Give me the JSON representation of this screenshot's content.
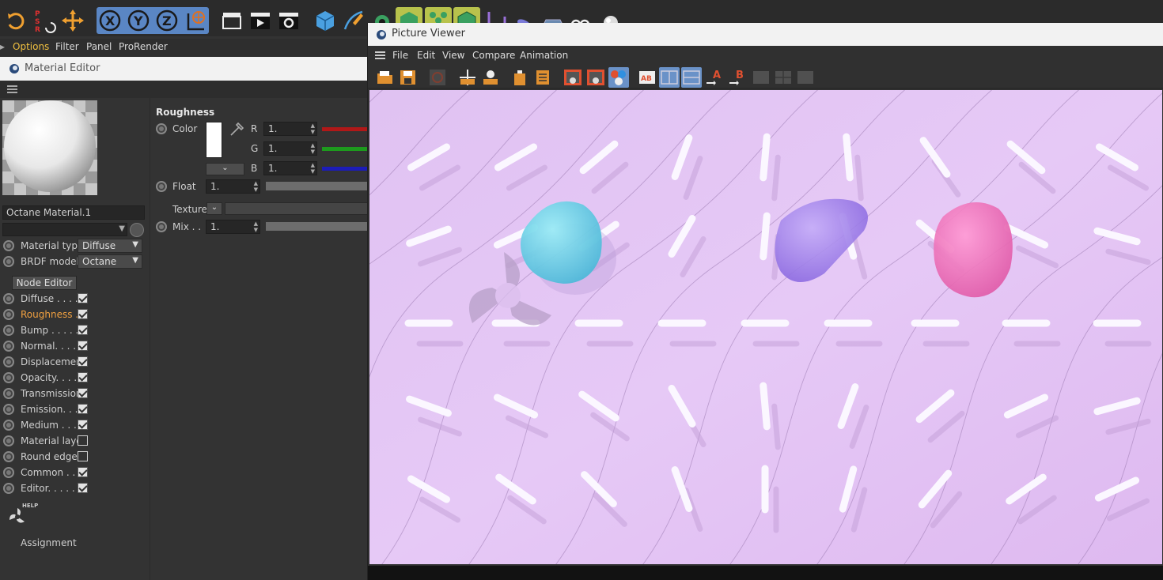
{
  "colors": {
    "accent_blue": "#5a86c4",
    "highlight_yellow": "#b8c24c",
    "active_orange": "#f0a040",
    "render_bg": "#e4c4f4",
    "blob_cyan": "#6fd6e4",
    "blob_purple": "#a98af0",
    "blob_pink": "#f57ac0"
  },
  "top_toolbar": {
    "icons": [
      "undo-icon",
      "psr-icon",
      "move-icon",
      "x-axis-icon",
      "y-axis-icon",
      "z-axis-icon",
      "world-coord-icon",
      "clapper-icon",
      "render-view-icon",
      "render-settings-icon",
      "cube-icon",
      "pen-icon",
      "generator-icon",
      "subdivision-icon",
      "cloner-icon",
      "deformer-icon",
      "bend-icon",
      "bevel-icon",
      "floor-icon",
      "camera-icon",
      "light-icon"
    ],
    "psr_label": "P\nS\nR",
    "x_label": "X",
    "y_label": "Y",
    "z_label": "Z"
  },
  "menubar": {
    "items": [
      {
        "label": "Options",
        "active": true
      },
      {
        "label": "Filter",
        "active": false
      },
      {
        "label": "Panel",
        "active": false
      },
      {
        "label": "ProRender",
        "active": false
      }
    ],
    "left_stub": "▸"
  },
  "material_editor": {
    "title": "Material Editor",
    "material_name": "Octane Material.1",
    "material_type_label": "Material type",
    "material_type_value": "Diffuse",
    "brdf_label": "BRDF model",
    "brdf_value": "Octane",
    "node_editor_label": "Node Editor",
    "channels": [
      {
        "label": "Diffuse . . . .",
        "checked": true,
        "active": false
      },
      {
        "label": "Roughness .",
        "checked": true,
        "active": true
      },
      {
        "label": "Bump . . . . .",
        "checked": true,
        "active": false
      },
      {
        "label": "Normal. . . .",
        "checked": true,
        "active": false
      },
      {
        "label": "Displacement",
        "checked": true,
        "active": false
      },
      {
        "label": "Opacity. . . .",
        "checked": true,
        "active": false
      },
      {
        "label": "Transmission",
        "checked": true,
        "active": false
      },
      {
        "label": "Emission. . .",
        "checked": true,
        "active": false
      },
      {
        "label": "Medium . . .",
        "checked": true,
        "active": false
      },
      {
        "label": "Material layer",
        "checked": false,
        "active": false
      },
      {
        "label": "Round edges",
        "checked": false,
        "active": false
      },
      {
        "label": "Common . .",
        "checked": true,
        "active": false
      },
      {
        "label": "Editor. . . . .",
        "checked": true,
        "active": false
      }
    ],
    "help_label": "HELP",
    "assignment_label": "Assignment",
    "settings": {
      "section_title": "Roughness",
      "color_label": "Color",
      "r_label": "R",
      "g_label": "G",
      "b_label": "B",
      "r_value": "1.",
      "g_value": "1.",
      "b_value": "1.",
      "float_label": "Float",
      "float_value": "1.",
      "texture_label": "Texture",
      "mix_label": "Mix . .",
      "mix_value": "1."
    }
  },
  "picture_viewer": {
    "title": "Picture Viewer",
    "menu": [
      "File",
      "Edit",
      "View",
      "Compare",
      "Animation"
    ],
    "tool_icons": [
      "open-icon",
      "save-icon",
      "stop-icon",
      "render-region-icon",
      "render-object-icon",
      "delete-icon",
      "layer-stack-icon",
      "frame-a-icon",
      "frame-b-icon",
      "compare-icon",
      "ab-icon",
      "split-icon",
      "split-alt-icon",
      "set-a-icon",
      "set-b-icon",
      "swap-icon",
      "grid-icon",
      "history-icon"
    ],
    "a_label": "A",
    "b_label": "B",
    "ab_label": "AB"
  }
}
